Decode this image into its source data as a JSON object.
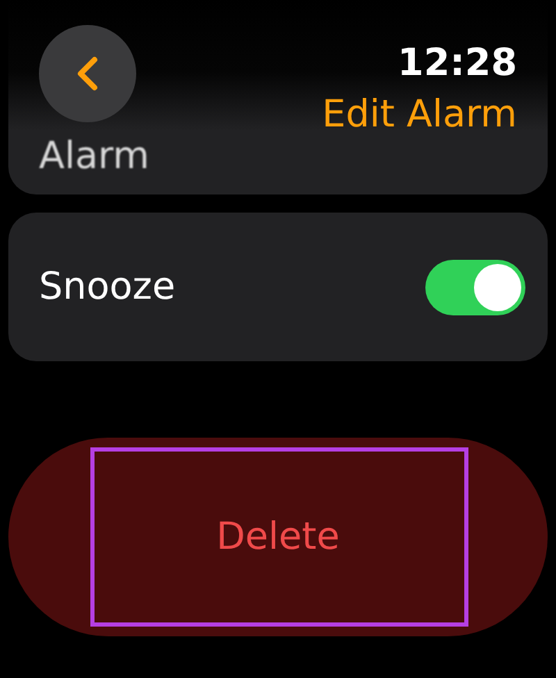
{
  "header": {
    "time": "12:28",
    "title": "Edit Alarm"
  },
  "alarm_card": {
    "label": "Alarm"
  },
  "settings": [
    {
      "label": "Snooze",
      "kind": "toggle",
      "on": true
    }
  ],
  "delete_button": {
    "label": "Delete",
    "highlighted": true
  }
}
